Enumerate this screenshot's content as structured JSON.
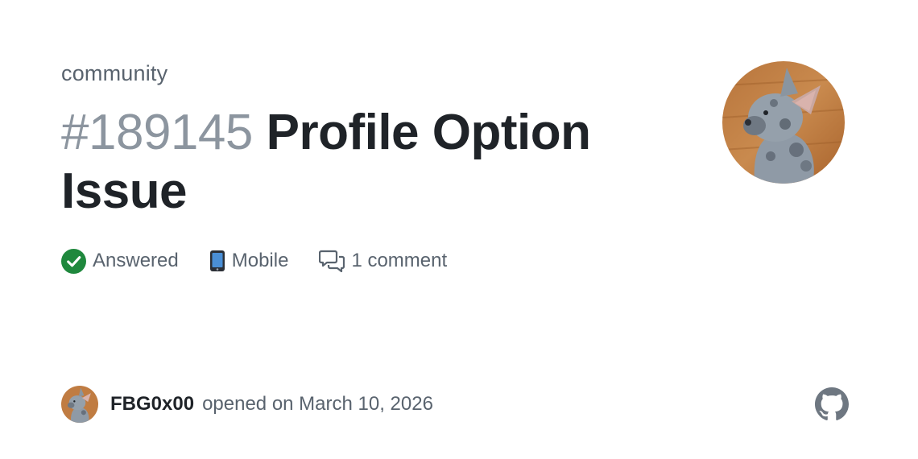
{
  "repo": {
    "name": "community"
  },
  "issue": {
    "number": "#189145",
    "title": "Profile Option Issue"
  },
  "meta": {
    "status": {
      "label": "Answered",
      "icon": "check-circle-icon",
      "color": "#1f883d"
    },
    "category": {
      "emoji": "📱",
      "label": "Mobile"
    },
    "comments": {
      "label": "1 comment",
      "icon": "comment-discussion-icon"
    }
  },
  "footer": {
    "author": "FBG0x00",
    "opened_text": "opened on March 10, 2026"
  },
  "branding": {
    "logo_icon": "github-icon",
    "logo_color": "#6e7781"
  },
  "avatar": {
    "subject": "french-bulldog-photo"
  }
}
